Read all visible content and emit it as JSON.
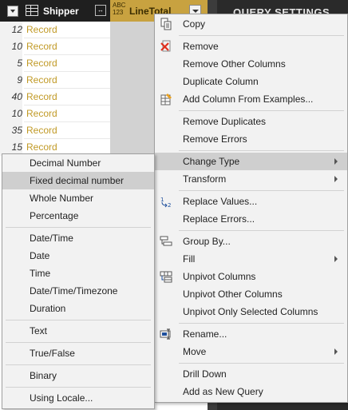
{
  "grid": {
    "col1_title": "Shipper",
    "col2_type": "ABC\n123",
    "col2_title": "LineTotal",
    "rows": [
      {
        "num": "12",
        "val": "Record"
      },
      {
        "num": "10",
        "val": "Record"
      },
      {
        "num": "5",
        "val": "Record"
      },
      {
        "num": "9",
        "val": "Record"
      },
      {
        "num": "40",
        "val": "Record"
      },
      {
        "num": "10",
        "val": "Record"
      },
      {
        "num": "35",
        "val": "Record"
      },
      {
        "num": "15",
        "val": "Record"
      }
    ]
  },
  "pane": {
    "title": "QUERY SETTINGS"
  },
  "context_menu": {
    "copy": "Copy",
    "remove": "Remove",
    "remove_other": "Remove Other Columns",
    "duplicate": "Duplicate Column",
    "add_from_examples": "Add Column From Examples...",
    "remove_duplicates": "Remove Duplicates",
    "remove_errors": "Remove Errors",
    "change_type": "Change Type",
    "transform": "Transform",
    "replace_values": "Replace Values...",
    "replace_errors": "Replace Errors...",
    "group_by": "Group By...",
    "fill": "Fill",
    "unpivot": "Unpivot Columns",
    "unpivot_other": "Unpivot Other Columns",
    "unpivot_selected": "Unpivot Only Selected Columns",
    "rename": "Rename...",
    "move": "Move",
    "drill_down": "Drill Down",
    "add_as_new_query": "Add as New Query"
  },
  "type_submenu": {
    "decimal": "Decimal Number",
    "fixed_decimal": "Fixed decimal number",
    "whole": "Whole Number",
    "percentage": "Percentage",
    "datetime": "Date/Time",
    "date": "Date",
    "time": "Time",
    "datetimezone": "Date/Time/Timezone",
    "duration": "Duration",
    "text": "Text",
    "truefalse": "True/False",
    "binary": "Binary",
    "using_locale": "Using Locale..."
  },
  "colors": {
    "header_bg": "#1f1f1f",
    "selected_column_header": "#c8a240",
    "record_link": "#c19a26",
    "menu_bg": "#f2f2f2",
    "menu_highlight": "#cfcfcf",
    "remove_icon_red": "#e0301e"
  }
}
